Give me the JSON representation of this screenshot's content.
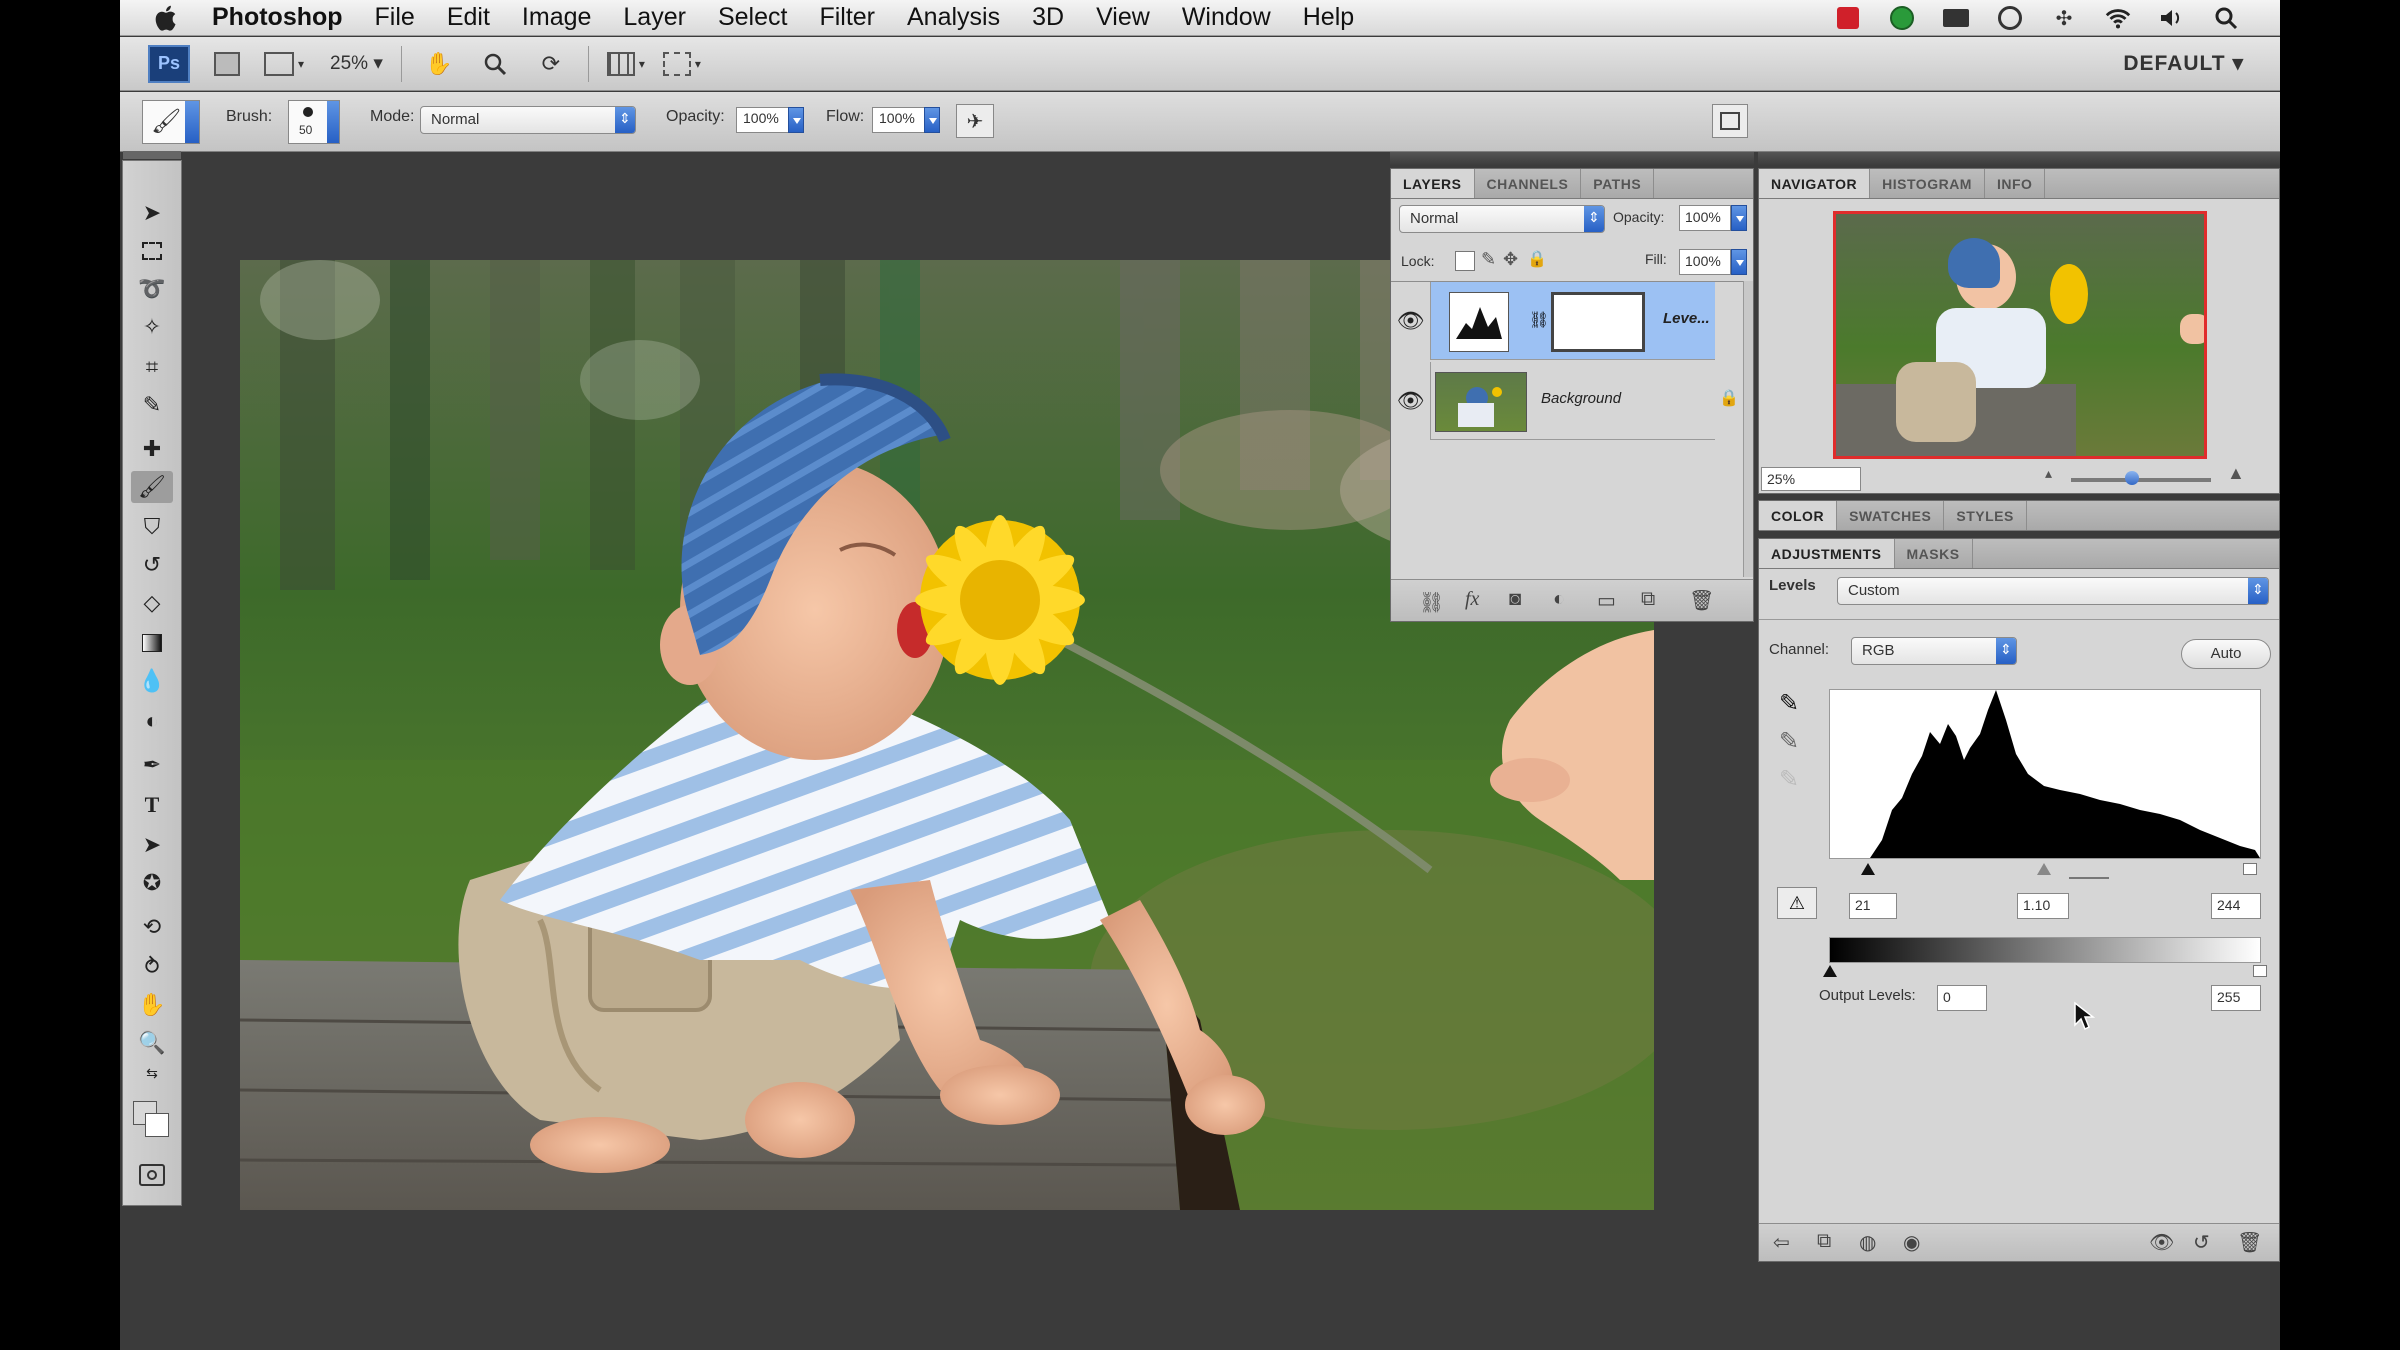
{
  "menubar": {
    "app_name": "Photoshop",
    "items": [
      "File",
      "Edit",
      "Image",
      "Layer",
      "Select",
      "Filter",
      "Analysis",
      "3D",
      "View",
      "Window",
      "Help"
    ]
  },
  "appbar": {
    "ps_logo": "Ps",
    "zoom": "25%",
    "workspace": "DEFAULT ▾"
  },
  "options": {
    "brush_label": "Brush:",
    "brush_size": "50",
    "mode_label": "Mode:",
    "mode_value": "Normal",
    "opacity_label": "Opacity:",
    "opacity_value": "100%",
    "flow_label": "Flow:",
    "flow_value": "100%"
  },
  "layers_panel": {
    "tabs": [
      "LAYERS",
      "CHANNELS",
      "PATHS"
    ],
    "blend_mode": "Normal",
    "opacity_label": "Opacity:",
    "opacity_value": "100%",
    "lock_label": "Lock:",
    "fill_label": "Fill:",
    "fill_value": "100%",
    "layers": [
      {
        "name": "Leve...",
        "selected": true
      },
      {
        "name": "Background",
        "selected": false
      }
    ]
  },
  "navigator_panel": {
    "tabs": [
      "NAVIGATOR",
      "HISTOGRAM",
      "INFO"
    ],
    "zoom": "25%"
  },
  "color_panel": {
    "tabs": [
      "COLOR",
      "SWATCHES",
      "STYLES"
    ]
  },
  "adjustments_panel": {
    "tabs": [
      "ADJUSTMENTS",
      "MASKS"
    ],
    "type_label": "Levels",
    "preset": "Custom",
    "channel_label": "Channel:",
    "channel_value": "RGB",
    "auto_label": "Auto",
    "input_black": "21",
    "input_gamma": "1.10",
    "input_white": "244",
    "output_label": "Output Levels:",
    "output_black": "0",
    "output_white": "255"
  },
  "colors": {
    "selection": "#9cc1f3",
    "panel_bg": "#d6d6d6",
    "workspace_bg": "#3b3b3b"
  }
}
